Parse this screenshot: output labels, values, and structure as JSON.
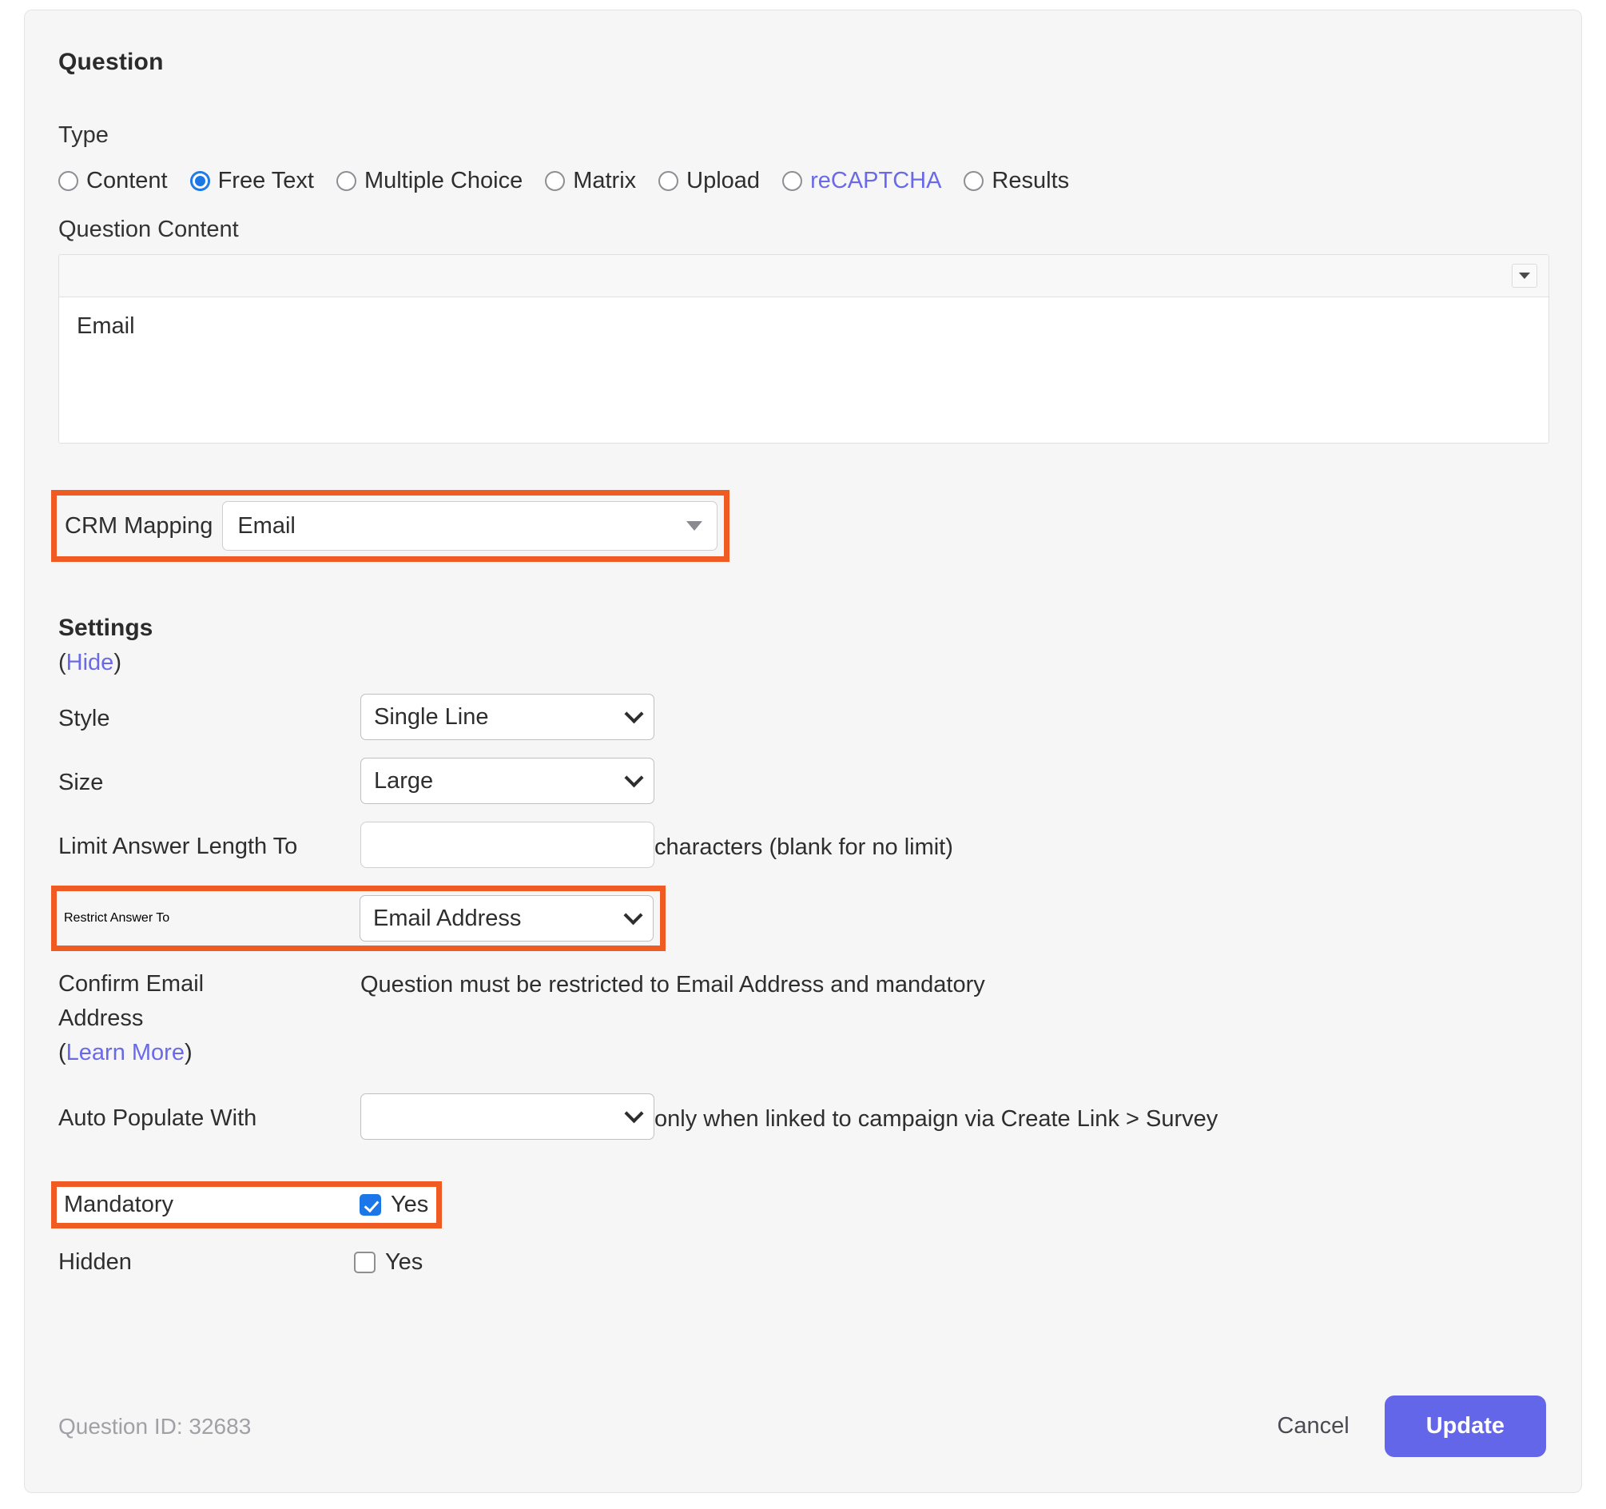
{
  "card": {
    "title": "Question"
  },
  "type_section": {
    "label": "Type",
    "options": [
      {
        "label": "Content",
        "selected": false,
        "link": false
      },
      {
        "label": "Free Text",
        "selected": true,
        "link": false
      },
      {
        "label": "Multiple Choice",
        "selected": false,
        "link": false
      },
      {
        "label": "Matrix",
        "selected": false,
        "link": false
      },
      {
        "label": "Upload",
        "selected": false,
        "link": false
      },
      {
        "label": "reCAPTCHA",
        "selected": false,
        "link": true
      },
      {
        "label": "Results",
        "selected": false,
        "link": false
      }
    ]
  },
  "question_content": {
    "label": "Question Content",
    "value": "Email",
    "toolbar_dropdown_icon": "caret-down-icon"
  },
  "crm_mapping": {
    "label": "CRM Mapping",
    "value": "Email",
    "highlighted": true
  },
  "settings": {
    "title": "Settings",
    "toggle_open_paren": "(",
    "toggle_label": "Hide",
    "toggle_close_paren": ")",
    "style": {
      "label": "Style",
      "value": "Single Line"
    },
    "size": {
      "label": "Size",
      "value": "Large"
    },
    "limit_answer_length": {
      "label": "Limit Answer Length To",
      "value": "",
      "suffix": "characters (blank for no limit)"
    },
    "restrict_answer_to": {
      "label": "Restrict Answer To",
      "value": "Email Address",
      "highlighted": true
    },
    "confirm_email_address": {
      "label_line1": "Confirm Email",
      "label_line2": "Address",
      "link_open_paren": "(",
      "link_label": "Learn More",
      "link_close_paren": ")",
      "note": "Question must be restricted to Email Address and mandatory"
    },
    "auto_populate_with": {
      "label": "Auto Populate With",
      "value": "",
      "suffix": "only when linked to campaign via Create Link > Survey"
    },
    "mandatory": {
      "label": "Mandatory",
      "checkbox_label": "Yes",
      "checked": true,
      "highlighted": true
    },
    "hidden": {
      "label": "Hidden",
      "checkbox_label": "Yes",
      "checked": false
    }
  },
  "footer": {
    "question_id": "Question ID: 32683",
    "cancel_label": "Cancel",
    "update_label": "Update"
  },
  "colors": {
    "highlight": "#ef5b23",
    "accent_blue": "#1b76e8",
    "link_purple": "#6a6ae8",
    "primary_button": "#6366e8",
    "card_bg": "#f6f6f7"
  }
}
